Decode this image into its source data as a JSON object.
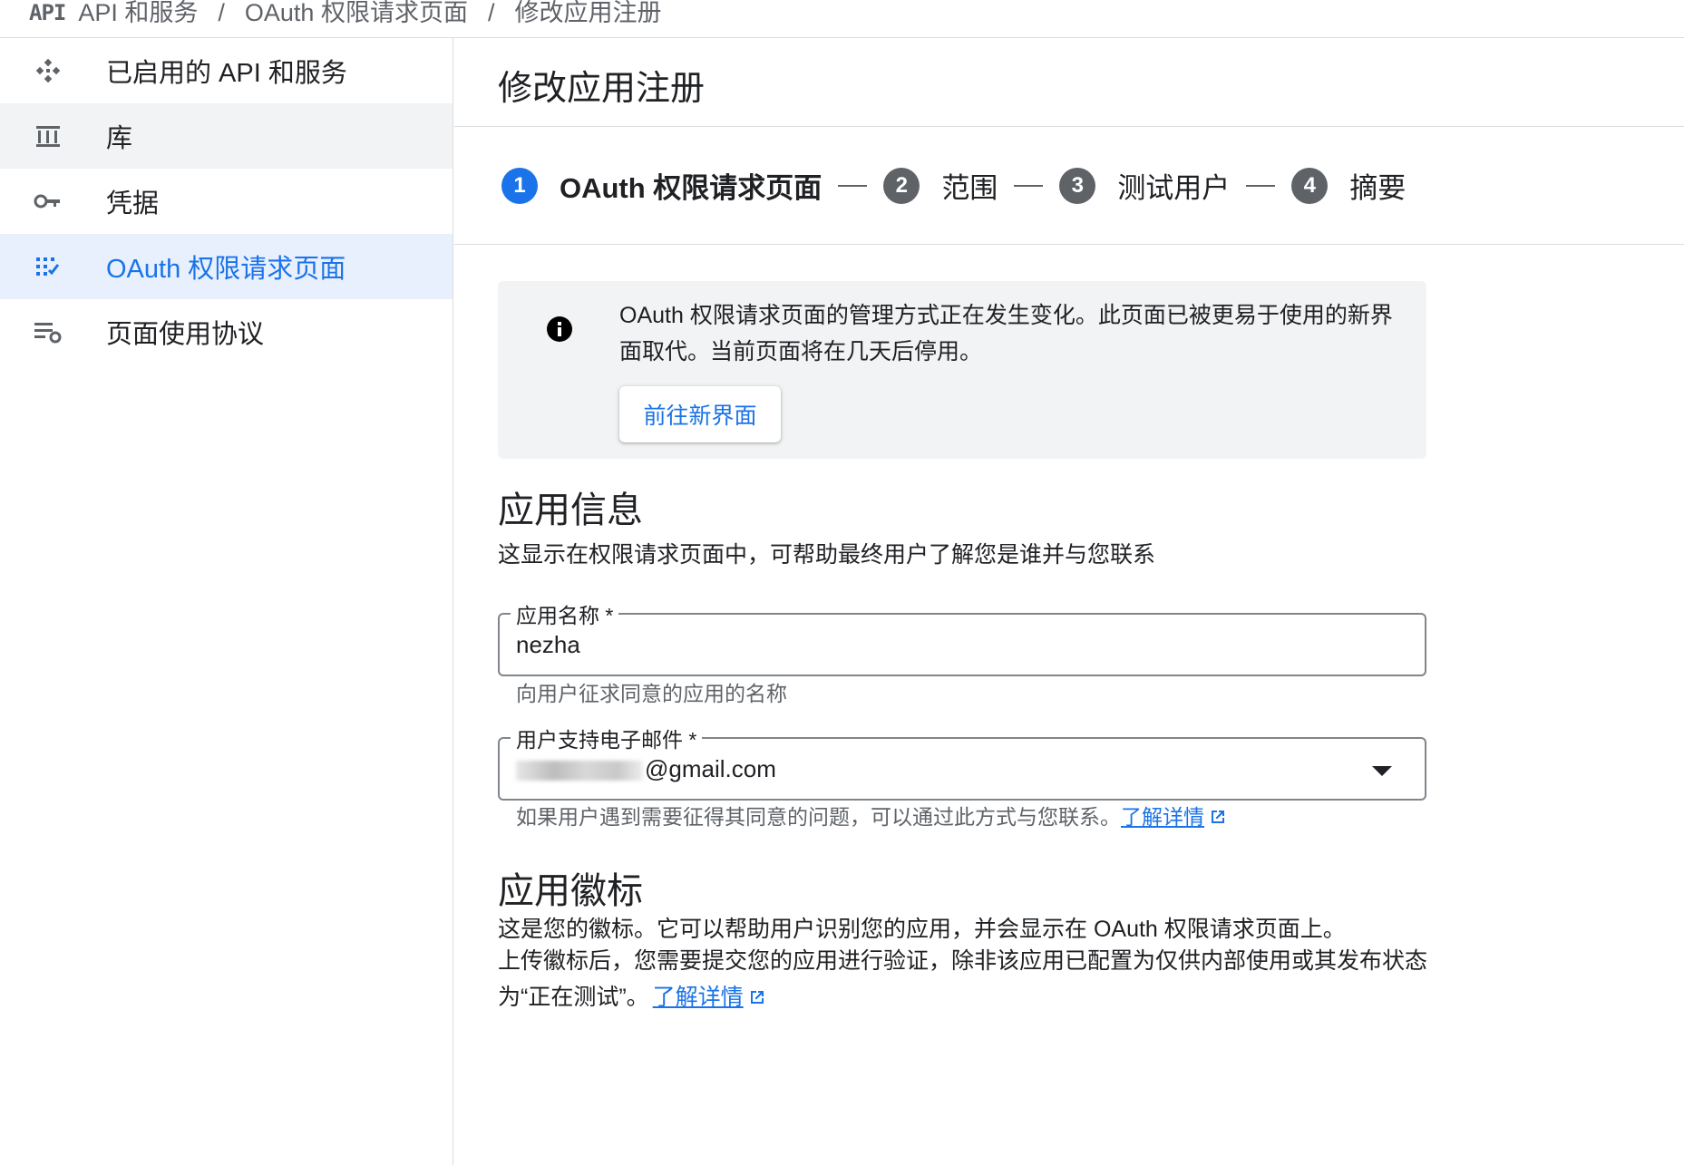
{
  "breadcrumb": {
    "logo": "API",
    "items": [
      "API 和服务",
      "OAuth 权限请求页面",
      "修改应用注册"
    ],
    "separator": "/"
  },
  "sidebar": {
    "items": [
      {
        "label": "已启用的 API 和服务",
        "icon": "api-services-icon"
      },
      {
        "label": "库",
        "icon": "library-icon"
      },
      {
        "label": "凭据",
        "icon": "key-icon"
      },
      {
        "label": "OAuth 权限请求页面",
        "icon": "oauth-consent-icon",
        "active": true
      },
      {
        "label": "页面使用协议",
        "icon": "page-usage-agreement-icon"
      }
    ]
  },
  "page": {
    "title": "修改应用注册"
  },
  "stepper": {
    "separator": "—",
    "steps": [
      {
        "num": "1",
        "label": "OAuth 权限请求页面"
      },
      {
        "num": "2",
        "label": "范围"
      },
      {
        "num": "3",
        "label": "测试用户"
      },
      {
        "num": "4",
        "label": "摘要"
      }
    ]
  },
  "notice": {
    "icon": "info-icon",
    "text": "OAuth 权限请求页面的管理方式正在发生变化。此页面已被更易于使用的新界面取代。当前页面将在几天后停用。",
    "button": "前往新界面"
  },
  "app_info": {
    "title": "应用信息",
    "desc": "这显示在权限请求页面中，可帮助最终用户了解您是谁并与您联系",
    "name_field": {
      "label": "应用名称 *",
      "value": "nezha",
      "hint": "向用户征求同意的应用的名称"
    },
    "email_field": {
      "label": "用户支持电子邮件 *",
      "value_suffix": "@gmail.com",
      "hint": "如果用户遇到需要征得其同意的问题，可以通过此方式与您联系。",
      "learn_more": "了解详情"
    }
  },
  "app_logo": {
    "title": "应用徽标",
    "desc_line1": "这是您的徽标。它可以帮助用户识别您的应用，并会显示在 OAuth 权限请求页面上。",
    "desc_line2": "上传徽标后，您需要提交您的应用进行验证，除非该应用已配置为仅供内部使用或其发布状态为“正在测试”。",
    "learn_more": "了解详情"
  },
  "colors": {
    "accent": "#1a73e8",
    "active_bg": "#e8f0fe",
    "notice_bg": "#f1f3f4"
  }
}
